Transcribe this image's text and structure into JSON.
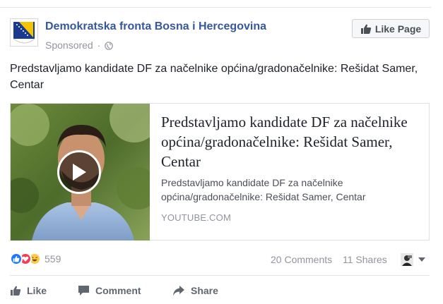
{
  "page": {
    "name": "Demokratska fronta Bosna i Hercegovina",
    "sponsored_label": "Sponsored",
    "separator": "·",
    "like_page_label": "Like Page"
  },
  "post": {
    "text": "Predstavljamo kandidate DF za načelnike općina/gradonačelnike: Rešidat Samer, Centar"
  },
  "link_card": {
    "title": "Predstavljamo kandidate DF za načelnike općina/gradonačelnike: Rešidat Samer, Centar",
    "description": "Predstavljamo kandidate DF za načelnike općina/gradonačelnike: Rešidat Samer, Centar",
    "domain": "YOUTUBE.COM"
  },
  "stats": {
    "reactions": [
      "like-icon",
      "love-icon",
      "haha-icon"
    ],
    "reaction_count": "559",
    "comments": "20 Comments",
    "shares": "11 Shares"
  },
  "actions": {
    "like": "Like",
    "comment": "Comment",
    "share": "Share"
  },
  "colors": {
    "link_blue": "#365899",
    "like_blue": "#2078f4",
    "love_red": "#f33e58",
    "haha_yellow": "#fcca49",
    "muted": "#90949c"
  }
}
